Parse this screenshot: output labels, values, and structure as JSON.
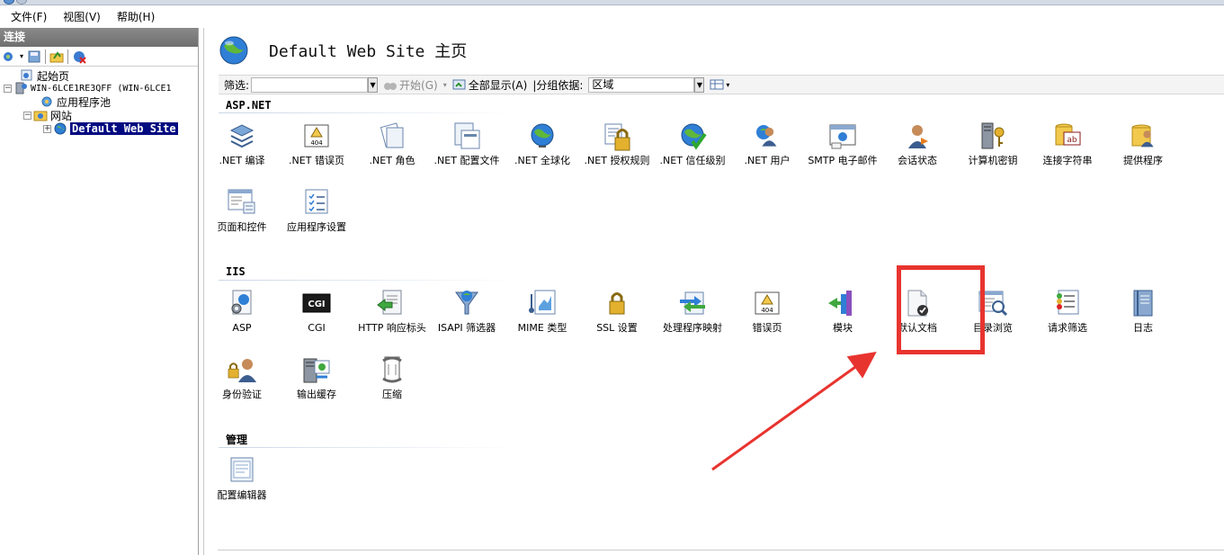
{
  "menu": {
    "file": "文件(F)",
    "view": "视图(V)",
    "help": "帮助(H)"
  },
  "connections": {
    "header": "连接",
    "tree": {
      "start_page": "起始页",
      "server": "WIN-6LCE1RE3QFF (WIN-6LCE1",
      "app_pools": "应用程序池",
      "sites": "网站",
      "default_site": "Default Web Site"
    }
  },
  "main": {
    "title": "Default Web Site 主页",
    "filter": {
      "label": "筛选:",
      "start": "开始(G)",
      "show_all": "全部显示(A)",
      "group_by": "|分组依据:",
      "group_value": "区域"
    },
    "sections": {
      "aspnet": "ASP.NET",
      "iis": "IIS",
      "manage": "管理"
    },
    "aspnet_items": [
      {
        "label": ".NET 编译",
        "icon": "dotnet-compile-icon"
      },
      {
        "label": ".NET 错误页",
        "icon": "dotnet-error-pages-icon"
      },
      {
        "label": ".NET 角色",
        "icon": "dotnet-roles-icon"
      },
      {
        "label": ".NET 配置文件",
        "icon": "dotnet-profile-icon"
      },
      {
        "label": ".NET 全球化",
        "icon": "dotnet-globalization-icon"
      },
      {
        "label": ".NET 授权规则",
        "icon": "dotnet-authorization-icon"
      },
      {
        "label": ".NET 信任级别",
        "icon": "dotnet-trust-levels-icon"
      },
      {
        "label": ".NET 用户",
        "icon": "dotnet-users-icon"
      },
      {
        "label": "SMTP 电子邮件",
        "icon": "smtp-email-icon"
      },
      {
        "label": "会话状态",
        "icon": "session-state-icon"
      },
      {
        "label": "计算机密钥",
        "icon": "machine-key-icon"
      },
      {
        "label": "连接字符串",
        "icon": "connection-strings-icon"
      },
      {
        "label": "提供程序",
        "icon": "providers-icon"
      },
      {
        "label": "页面和控件",
        "icon": "pages-controls-icon"
      },
      {
        "label": "应用程序设置",
        "icon": "app-settings-icon"
      }
    ],
    "iis_items": [
      {
        "label": "ASP",
        "icon": "asp-icon"
      },
      {
        "label": "CGI",
        "icon": "cgi-icon"
      },
      {
        "label": "HTTP 响应标头",
        "icon": "http-response-headers-icon"
      },
      {
        "label": "ISAPI 筛选器",
        "icon": "isapi-filters-icon"
      },
      {
        "label": "MIME 类型",
        "icon": "mime-types-icon"
      },
      {
        "label": "SSL 设置",
        "icon": "ssl-settings-icon"
      },
      {
        "label": "处理程序映射",
        "icon": "handler-mappings-icon"
      },
      {
        "label": "错误页",
        "icon": "error-pages-icon"
      },
      {
        "label": "模块",
        "icon": "modules-icon"
      },
      {
        "label": "默认文档",
        "icon": "default-document-icon"
      },
      {
        "label": "目录浏览",
        "icon": "directory-browsing-icon"
      },
      {
        "label": "请求筛选",
        "icon": "request-filtering-icon"
      },
      {
        "label": "日志",
        "icon": "logging-icon"
      },
      {
        "label": "身份验证",
        "icon": "authentication-icon"
      },
      {
        "label": "输出缓存",
        "icon": "output-caching-icon"
      },
      {
        "label": "压缩",
        "icon": "compression-icon"
      }
    ],
    "manage_items": [
      {
        "label": "配置编辑器",
        "icon": "configuration-editor-icon"
      }
    ],
    "cgi_text": "CGI",
    "error_icon_text": "404"
  },
  "colors": {
    "highlight": "#e8342f",
    "selection": "#000a80"
  }
}
